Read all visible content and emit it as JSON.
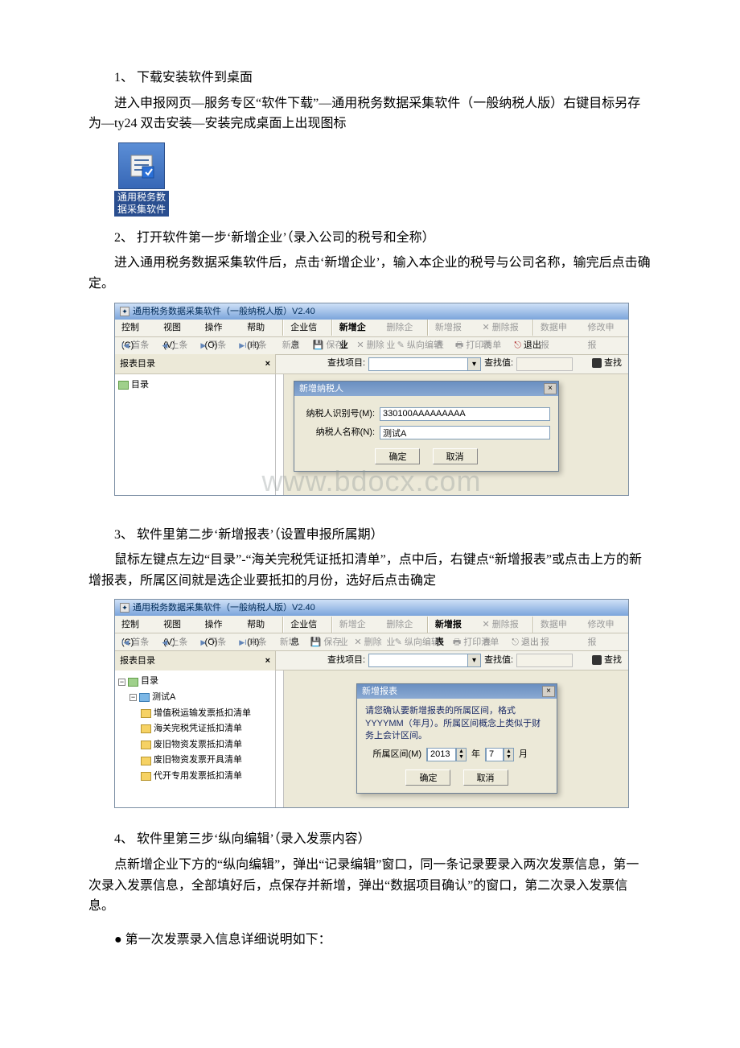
{
  "step1": {
    "heading": "1、 下载安装软件到桌面",
    "body": "进入申报网页—服务专区“软件下载”—通用税务数据采集软件（一般纳税人版）右键目标另存为—ty24 双击安装—安装完成桌面上出现图标"
  },
  "desktop_icon": {
    "line1": "通用税务数",
    "line2": "据采集软件"
  },
  "step2": {
    "heading": "2、 打开软件第一步‘新增企业’（录入公司的税号和全称）",
    "body": "进入通用税务数据采集软件后，点击‘新增企业’，输入本企业的税号与公司名称，输完后点击确定。"
  },
  "app1": {
    "title": "通用税务数据采集软件（一般纳税人版）V2.40",
    "menus": [
      "控制(C)",
      "视图(V)",
      "操作(O)",
      "帮助(H)"
    ],
    "toolbar_left": [
      "企业信息"
    ],
    "toolbar_mid": [
      "新增企业",
      "删除企业"
    ],
    "toolbar_right1": [
      "新增报表",
      "删除报表"
    ],
    "toolbar_right2": [
      "数据申报",
      "修改申报"
    ],
    "nav": [
      "首条",
      "上条",
      "下条",
      "末条"
    ],
    "nav_right": [
      "新增",
      "保存",
      "删除",
      "纵向编辑"
    ],
    "nav_far": [
      "打印清单",
      "退出"
    ],
    "search": {
      "left": "报表目录",
      "find_lbl": "查找项目:",
      "val_lbl": "查找值:",
      "btn": "查找"
    },
    "treeroot": "目录",
    "dialog": {
      "title": "新增纳税人",
      "id_label": "纳税人识别号(M):",
      "id_value": "330100AAAAAAAAA",
      "name_label": "纳税人名称(N):",
      "name_value": "测试A",
      "ok": "确定",
      "cancel": "取消"
    },
    "watermark": "www.bdocx.com"
  },
  "step3": {
    "heading": "3、 软件里第二步‘新增报表’（设置申报所属期）",
    "body": "鼠标左键点左边“目录”-“海关完税凭证抵扣清单”，点中后，右键点“新增报表”或点击上方的新增报表，所属区间就是选企业要抵扣的月份，选好后点击确定"
  },
  "app2": {
    "title": "通用税务数据采集软件（一般纳税人版）V2.40",
    "tree": {
      "root": "目录",
      "company": "测试A",
      "items": [
        "增值税运输发票抵扣清单",
        "海关完税凭证抵扣清单",
        "废旧物资发票抵扣清单",
        "废旧物资发票开具清单",
        "代开专用发票抵扣清单"
      ]
    },
    "dialog": {
      "title": "新增报表",
      "tip": "请您确认要新增报表的所属区间，格式YYYYMM（年月）。所属区间概念上类似于财务上会计区间。",
      "period_label": "所属区间(M)",
      "year": "2013",
      "year_unit": "年",
      "month": "7",
      "month_unit": "月",
      "ok": "确定",
      "cancel": "取消"
    }
  },
  "step4": {
    "heading": "4、 软件里第三步‘纵向编辑’（录入发票内容）",
    "body": "点新增企业下方的“纵向编辑”，弹出“记录编辑”窗口，同一条记录要录入两次发票信息，第一次录入发票信息，全部填好后，点保存并新增，弹出“数据项目确认”的窗口，第二次录入发票信息。",
    "bullet": "● 第一次发票录入信息详细说明如下："
  }
}
